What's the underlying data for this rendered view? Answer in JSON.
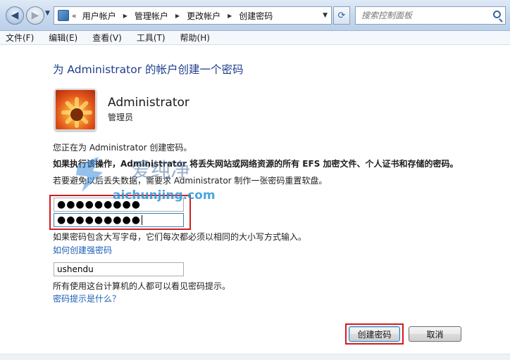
{
  "address_bar": {
    "chevron": "«",
    "breadcrumbs": [
      "用户帐户",
      "管理帐户",
      "更改帐户",
      "创建密码"
    ],
    "search_placeholder": "搜索控制面板"
  },
  "menu": [
    "文件(F)",
    "编辑(E)",
    "查看(V)",
    "工具(T)",
    "帮助(H)"
  ],
  "content": {
    "title": "为 Administrator 的帐户创建一个密码",
    "account_name": "Administrator",
    "account_role": "管理员",
    "creating_text": "您正在为 Administrator 创建密码。",
    "warning_text": "如果执行该操作，Administrator 将丢失网站或网络资源的所有 EFS 加密文件、个人证书和存储的密码。",
    "reset_text": "若要避免以后丢失数据，需要求 Administrator 制作一张密码重置软盘。",
    "new_password_value": "●●●●●●●●●",
    "confirm_password_value": "●●●●●●●●●",
    "case_text": "如果密码包含大写字母，它们每次都必须以相同的大小写方式输入。",
    "strong_link": "如何创建强密码",
    "hint_value": "ushendu",
    "hint_visible_text": "所有使用这台计算机的人都可以看见密码提示。",
    "hint_link": "密码提示是什么？"
  },
  "buttons": {
    "create": "创建密码",
    "cancel": "取消"
  },
  "watermark": {
    "cn": "爱纯净",
    "url": "aichunjing.com"
  },
  "colors": {
    "title": "#1e3e8c",
    "link": "#1d5fb9",
    "highlight": "#d31c1c"
  }
}
